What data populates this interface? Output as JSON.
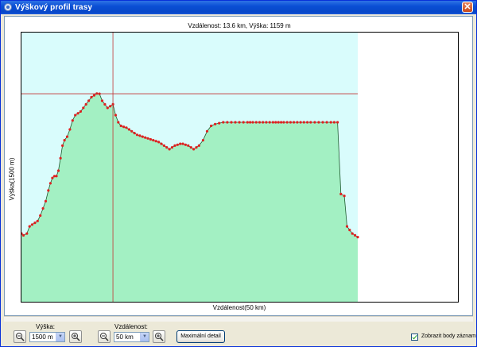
{
  "window": {
    "title": "Výškový profil trasy",
    "close_glyph": "✕"
  },
  "chart_data": {
    "type": "area",
    "title": "Vzdálenost: 13.6 km, Výška: 1159 m",
    "xlabel": "Vzdálenost(50 km)",
    "ylabel": "Výška(1500 m)",
    "xlim": [
      0,
      50
    ],
    "ylim": [
      0,
      1500
    ],
    "cursor": {
      "x": 13.6,
      "y": 1159
    },
    "fill_color": "#a3f0c3",
    "background_color": "#d9fcfc",
    "point_color": "#e02020",
    "series": [
      {
        "x": [
          0,
          0.3,
          0.8,
          1.2,
          1.6,
          2.0,
          2.4,
          2.8,
          3.2,
          3.6,
          4.0,
          4.3,
          4.6,
          4.9,
          5.2,
          5.5,
          5.8,
          6.1,
          6.4,
          6.8,
          7.2,
          7.6,
          8.0,
          8.4,
          8.8,
          9.2,
          9.6,
          10.0,
          10.4,
          10.8,
          11.2,
          11.6,
          12.0,
          12.4,
          12.8,
          13.2,
          13.6,
          14.0,
          14.4,
          14.8,
          15.2,
          15.6,
          16.0,
          16.4,
          16.8,
          17.2,
          17.6,
          18.0,
          18.4,
          18.8,
          19.2,
          19.6,
          20.0,
          20.4,
          20.8,
          21.2,
          21.6,
          22.0,
          22.4,
          22.8,
          23.2,
          23.6,
          24.0,
          24.4,
          24.8,
          25.2,
          25.6,
          26.0,
          26.4,
          27.0,
          27.6,
          28.2,
          28.8,
          29.4,
          30.0,
          30.6,
          31.2,
          31.8,
          32.4,
          33.0,
          33.6,
          34.0,
          34.4,
          34.9,
          35.4,
          35.9,
          36.4,
          36.9,
          37.4,
          37.8,
          38.2,
          38.6,
          39.0,
          39.5,
          40.0,
          40.5,
          41.0,
          41.5,
          42.0,
          42.5,
          43.0,
          43.6,
          44.2,
          44.8,
          45.4,
          46.0,
          46.5,
          47.0,
          47.5,
          48.0,
          48.4,
          48.8,
          49.2,
          49.6,
          50.0
        ],
        "values": [
          380,
          370,
          380,
          420,
          430,
          440,
          450,
          480,
          520,
          560,
          620,
          660,
          690,
          700,
          700,
          730,
          800,
          870,
          900,
          920,
          960,
          1010,
          1040,
          1050,
          1060,
          1080,
          1100,
          1120,
          1140,
          1150,
          1160,
          1159,
          1120,
          1100,
          1080,
          1090,
          1100,
          1040,
          1000,
          980,
          975,
          970,
          960,
          950,
          940,
          930,
          925,
          920,
          915,
          910,
          905,
          900,
          895,
          890,
          880,
          870,
          860,
          850,
          860,
          870,
          875,
          880,
          880,
          875,
          870,
          860,
          850,
          860,
          870,
          900,
          950,
          980,
          990,
          995,
          1000,
          1000,
          1000,
          1000,
          1000,
          1000,
          1000,
          1000,
          1000,
          1000,
          1000,
          1000,
          1000,
          1000,
          1000,
          1000,
          1000,
          1000,
          1000,
          1000,
          1000,
          1000,
          1000,
          1000,
          1000,
          1000,
          1000,
          1000,
          1000,
          1000,
          1000,
          1000,
          1000,
          1000,
          600,
          590,
          420,
          400,
          380,
          370,
          360
        ]
      }
    ]
  },
  "toolbar": {
    "height_label": "Výška:",
    "height_value": "1500 m",
    "distance_label": "Vzdálenost:",
    "distance_value": "50 km",
    "max_detail_label": "Maximální detail",
    "show_points_label": "Zobrazit body záznam",
    "show_points_checked": true
  }
}
